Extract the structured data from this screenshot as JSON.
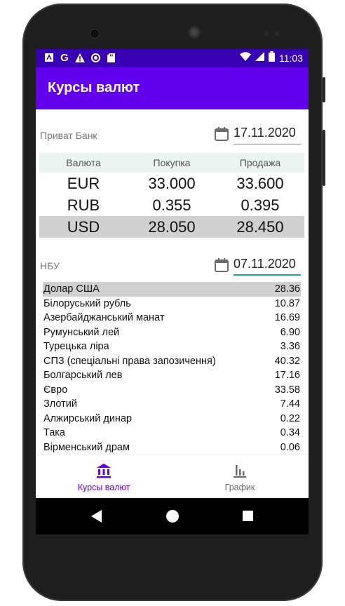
{
  "status_bar": {
    "time": "11:03",
    "left_icons": [
      "accessibility-icon",
      "google-icon",
      "warning-icon",
      "circle-icon",
      "sd-card-icon"
    ],
    "right_icons": [
      "wifi-icon",
      "signal-icon",
      "battery-icon"
    ]
  },
  "app_bar": {
    "title": "Курсы валют"
  },
  "privat": {
    "label": "Приват Банк",
    "date": "17.11.2020",
    "headers": [
      "Валюта",
      "Покупка",
      "Продажа"
    ],
    "rows": [
      {
        "currency": "EUR",
        "buy": "33.000",
        "sell": "33.600",
        "selected": false
      },
      {
        "currency": "RUB",
        "buy": "0.355",
        "sell": "0.395",
        "selected": false
      },
      {
        "currency": "USD",
        "buy": "28.050",
        "sell": "28.450",
        "selected": true
      }
    ]
  },
  "nbu": {
    "label": "НБУ",
    "date": "07.11.2020",
    "rows": [
      {
        "name": "Долар США",
        "rate": "28.36",
        "selected": true
      },
      {
        "name": "Білоруський рубль",
        "rate": "10.87"
      },
      {
        "name": "Азербайджанський манат",
        "rate": "16.69"
      },
      {
        "name": "Румунський лей",
        "rate": "6.90"
      },
      {
        "name": "Турецька ліра",
        "rate": "3.36"
      },
      {
        "name": "СПЗ (спеціальні права запозичення)",
        "rate": "40.32"
      },
      {
        "name": "Болгарський лев",
        "rate": "17.16"
      },
      {
        "name": "Євро",
        "rate": "33.58"
      },
      {
        "name": "Злотий",
        "rate": "7.44"
      },
      {
        "name": "Алжирський динар",
        "rate": "0.22"
      },
      {
        "name": "Така",
        "rate": "0.34"
      },
      {
        "name": "Вірменський драм",
        "rate": "0.06"
      }
    ]
  },
  "bottom_nav": {
    "items": [
      {
        "label": "Курсы валют",
        "icon": "bank-icon",
        "active": true
      },
      {
        "label": "График",
        "icon": "bar-chart-icon",
        "active": false
      }
    ]
  },
  "colors": {
    "primary": "#6200ee",
    "primary_dark": "#3700b3",
    "accent": "#26a69a",
    "header_bg": "#eaf4f1",
    "selected_row": "#d0d0d0"
  }
}
